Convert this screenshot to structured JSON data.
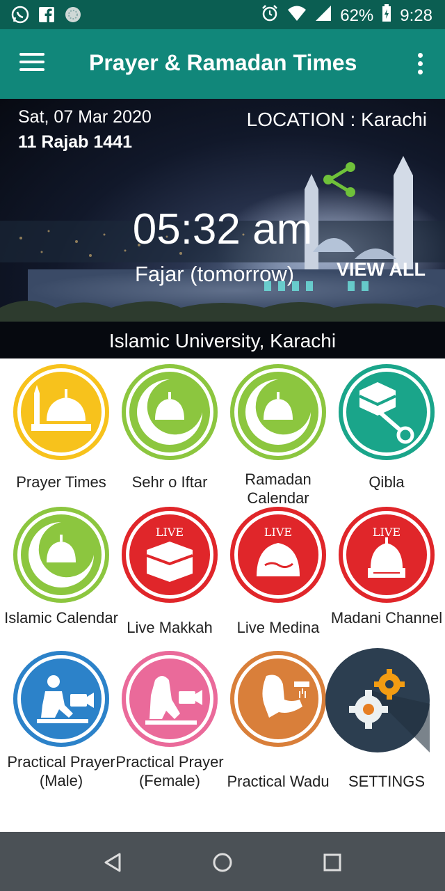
{
  "status_bar": {
    "battery": "62%",
    "time": "9:28",
    "icons": [
      "whatsapp-icon",
      "facebook-icon",
      "app-icon",
      "alarm-icon",
      "wifi-icon",
      "signal-icon",
      "battery-icon"
    ]
  },
  "app_bar": {
    "title": "Prayer & Ramadan Times",
    "icons": [
      "menu-icon",
      "overflow-icon"
    ]
  },
  "hero": {
    "gregorian_date": "Sat, 07 Mar 2020",
    "hijri_date": "11 Rajab 1441",
    "location": "LOCATION : Karachi",
    "next_prayer_time": "05:32 am",
    "next_prayer_name": "Fajar (tomorrow)",
    "view_all": "VIEW ALL",
    "place": "Islamic University, Karachi",
    "share_icon": "share-icon"
  },
  "tiles": [
    {
      "label": "Prayer Times",
      "icon": "mosque-icon",
      "color": "#f7c21c"
    },
    {
      "label": "Sehr o Iftar",
      "icon": "crescent-dome-icon",
      "color": "#8cc63f"
    },
    {
      "label": "Ramadan Calendar",
      "icon": "crescent-dome-icon",
      "color": "#8cc63f"
    },
    {
      "label": "Qibla",
      "icon": "kaaba-compass-icon",
      "color": "#1aa58a"
    },
    {
      "label": "Islamic Calendar",
      "icon": "crescent-dome-icon",
      "color": "#8cc63f"
    },
    {
      "label": "Live Makkah",
      "icon": "live-kaaba-icon",
      "color": "#e0262a",
      "badge": "LIVE"
    },
    {
      "label": "Live Medina",
      "icon": "live-medina-icon",
      "color": "#e0262a",
      "badge": "LIVE"
    },
    {
      "label": "Madani Channel",
      "icon": "live-channel-icon",
      "color": "#e0262a",
      "badge": "LIVE"
    },
    {
      "label": "Practical Prayer (Male)",
      "icon": "male-prayer-video-icon",
      "color": "#2c82c9"
    },
    {
      "label": "Practical Prayer (Female)",
      "icon": "female-prayer-video-icon",
      "color": "#ea6a9a"
    },
    {
      "label": "Practical Wadu",
      "icon": "wadu-icon",
      "color": "#d97f3a"
    },
    {
      "label": "SETTINGS",
      "icon": "gears-icon",
      "color": "#2c3e50"
    }
  ],
  "nav_bar": {
    "icons": [
      "back-icon",
      "home-icon",
      "recents-icon"
    ]
  }
}
